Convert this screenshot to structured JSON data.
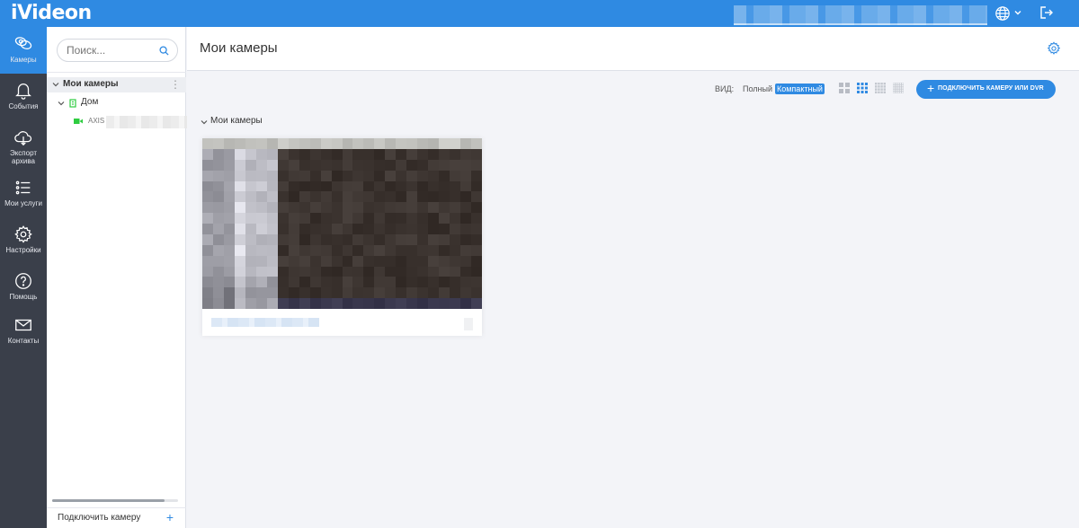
{
  "app": {
    "logo": "iVideon"
  },
  "nav": {
    "items": [
      {
        "label": "Камеры",
        "icon": "cameras-icon",
        "active": true
      },
      {
        "label": "События",
        "icon": "bell-icon",
        "active": false
      },
      {
        "label": "Экспорт архива",
        "icon": "cloud-download-icon",
        "active": false
      },
      {
        "label": "Мои услуги",
        "icon": "list-icon",
        "active": false
      },
      {
        "label": "Настройки",
        "icon": "gear-icon",
        "active": false
      },
      {
        "label": "Помощь",
        "icon": "help-icon",
        "active": false
      },
      {
        "label": "Контакты",
        "icon": "mail-icon",
        "active": false
      }
    ]
  },
  "tree": {
    "search_placeholder": "Поиск...",
    "root": "Мои камеры",
    "folder": "Дом",
    "camera": "AXIS",
    "footer": "Подключить камеру"
  },
  "main": {
    "title": "Мои камеры",
    "view_label": "ВИД:",
    "view_full": "Полный",
    "view_compact": "Компактный",
    "add_camera": "ПОДКЛЮЧИТЬ КАМЕРУ ИЛИ DVR",
    "group": "Мои камеры"
  },
  "colors": {
    "accent": "#2f8ae2",
    "nav_bg": "#3a3f4a",
    "online": "#2ecc40"
  }
}
